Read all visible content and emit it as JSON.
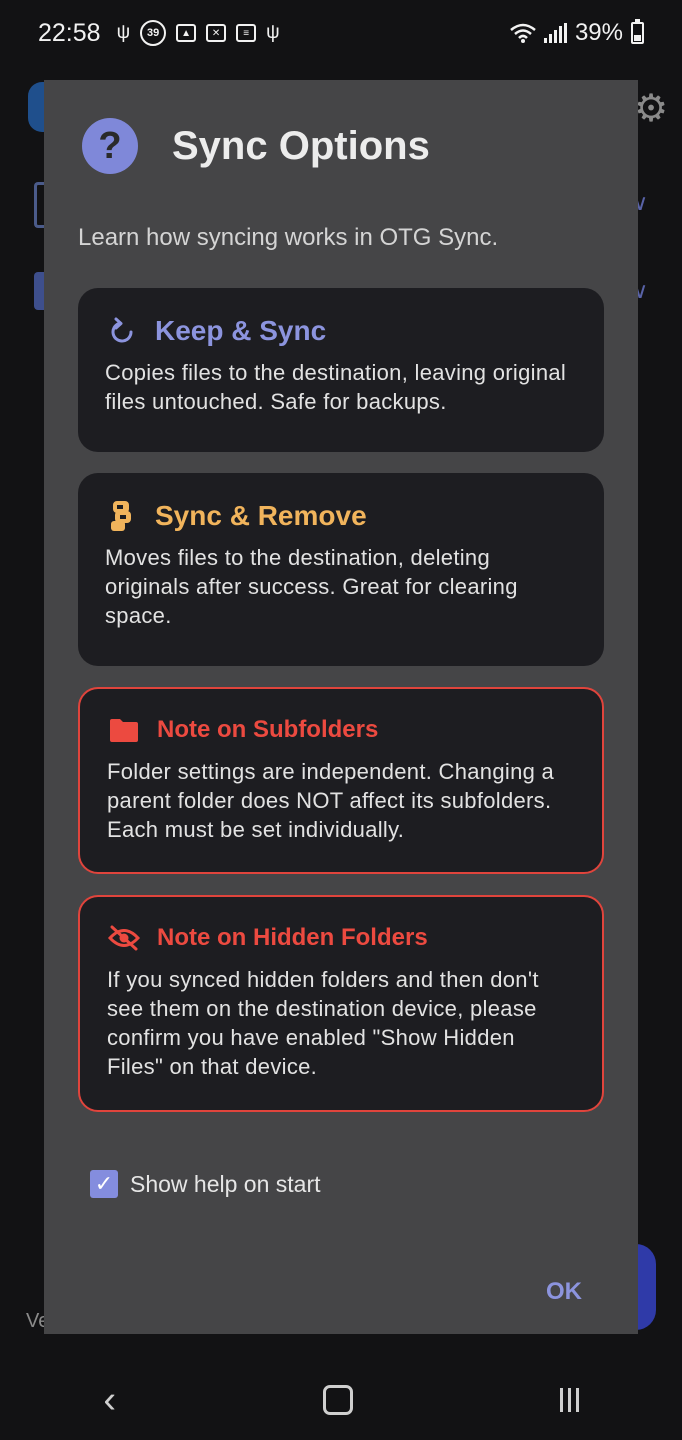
{
  "status_bar": {
    "time": "22:58",
    "notification_badge": "39",
    "battery": "39%",
    "battery_level": 0.39
  },
  "dialog": {
    "title": "Sync Options",
    "subtitle": "Learn how syncing works in OTG Sync.",
    "cards": [
      {
        "title": "Keep & Sync",
        "body": "Copies files to the destination, leaving original files untouched. Safe for backups.",
        "icon": "refresh-icon",
        "color": "#8c94de"
      },
      {
        "title": "Sync & Remove",
        "body": "Moves files to the destination, deleting originals after success. Great for clearing space.",
        "icon": "move-icon",
        "color": "#f1b45c"
      },
      {
        "title": "Note on Subfolders",
        "body": "Folder settings are independent. Changing a parent folder does NOT affect its subfolders. Each must be set individually.",
        "icon": "folder-icon",
        "color": "#ec4a40"
      },
      {
        "title": "Note on Hidden Folders",
        "body": "If you synced hidden folders and then don't see them on the destination device, please confirm you have enabled \"Show Hidden Files\" on that device.",
        "icon": "eye-off-icon",
        "color": "#ec4a40"
      }
    ],
    "checkbox_label": "Show help on start",
    "checkbox_checked": true,
    "ok_label": "OK"
  },
  "background": {
    "version_fragment": "Ve"
  }
}
